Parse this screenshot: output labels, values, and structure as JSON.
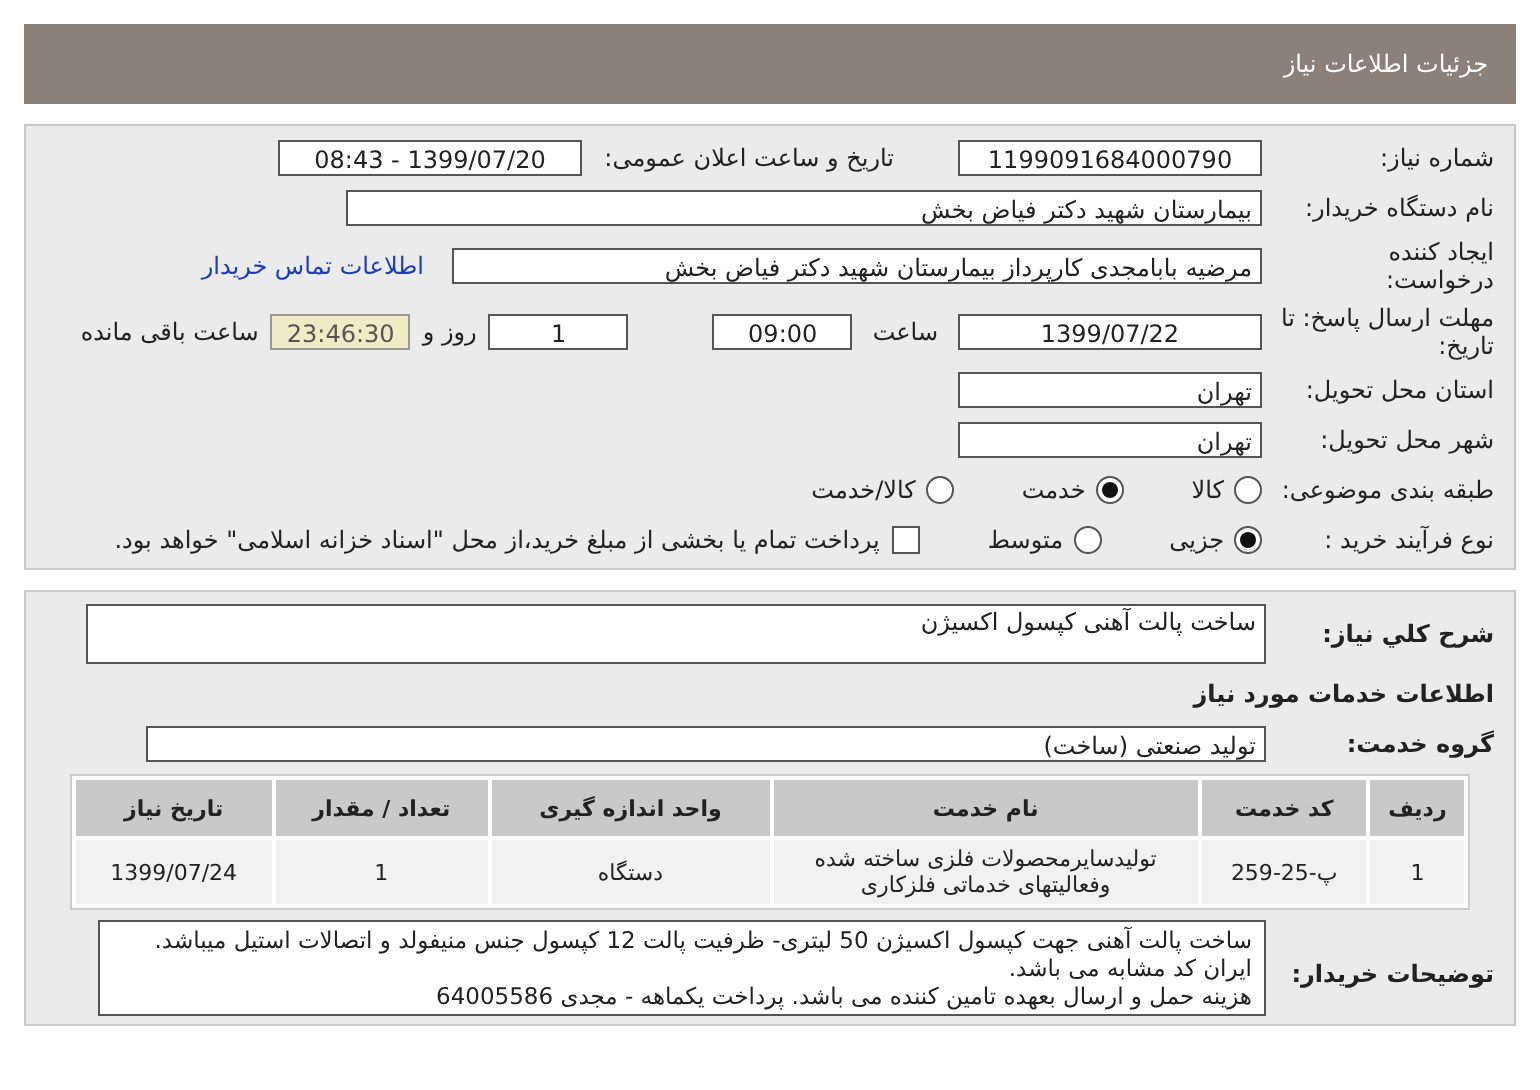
{
  "header": {
    "title": "جزئیات اطلاعات نیاز"
  },
  "need_number": {
    "label": "شماره نیاز:",
    "value": "1199091684000790"
  },
  "announce_date": {
    "label": "تاریخ و ساعت اعلان عمومی:",
    "value": "1399/07/20 - 08:43"
  },
  "buyer_org": {
    "label": "نام دستگاه خریدار:",
    "value": "بیمارستان شهید دکتر فیاض بخش"
  },
  "requester": {
    "label": "ایجاد کننده درخواست:",
    "value": "مرضیه بابامجدی کارپرداز بیمارستان شهید دکتر فیاض بخش",
    "link": "اطلاعات تماس خریدار"
  },
  "deadline": {
    "label": "مهلت ارسال پاسخ: تا تاریخ:",
    "date": "1399/07/22",
    "time_label": "ساعت",
    "time": "09:00",
    "days": "1",
    "days_label": "روز و",
    "remaining": "23:46:30",
    "remaining_label": "ساعت باقی مانده"
  },
  "province": {
    "label": "استان محل تحویل:",
    "value": "تهران"
  },
  "city": {
    "label": "شهر محل تحویل:",
    "value": "تهران"
  },
  "category": {
    "label": "طبقه بندی موضوعی:",
    "options": [
      {
        "label": "کالا",
        "selected": false
      },
      {
        "label": "خدمت",
        "selected": true
      },
      {
        "label": "کالا/خدمت",
        "selected": false
      }
    ]
  },
  "process": {
    "label": "نوع فرآیند خرید :",
    "options": [
      {
        "label": "جزیی",
        "selected": true
      },
      {
        "label": "متوسط",
        "selected": false
      }
    ],
    "treasury": {
      "checked": false,
      "label": "پرداخت تمام یا بخشی از مبلغ خرید،از محل \"اسناد خزانه اسلامی\" خواهد بود."
    }
  },
  "summary": {
    "label": "شرح کلي نياز:",
    "value": "ساخت پالت آهنی کپسول اکسیژن"
  },
  "services_heading": "اطلاعات خدمات مورد نیاز",
  "service_group": {
    "label": "گروه خدمت:",
    "value": "تولید صنعتی (ساخت)"
  },
  "table": {
    "columns": [
      "ردیف",
      "کد خدمت",
      "نام خدمت",
      "واحد اندازه گیری",
      "تعداد / مقدار",
      "تاریخ نیاز"
    ],
    "rows": [
      [
        "1",
        "پ-25-259",
        "تولیدسایرمحصولات فلزی ساخته شده وفعالیتهای خدماتی فلزکاری",
        "دستگاه",
        "1",
        "1399/07/24"
      ]
    ]
  },
  "buyer_notes": {
    "label": "توضیحات خریدار:",
    "lines": [
      "ساخت پالت آهنی جهت کپسول اکسیژن 50 لیتری- ظرفیت پالت 12 کپسول جنس منیفولد و اتصالات استیل میباشد. ایران کد مشابه می باشد.",
      "هزینه حمل و ارسال بعهده تامین کننده می باشد. پرداخت یکماهه - مجدی 64005586"
    ]
  }
}
